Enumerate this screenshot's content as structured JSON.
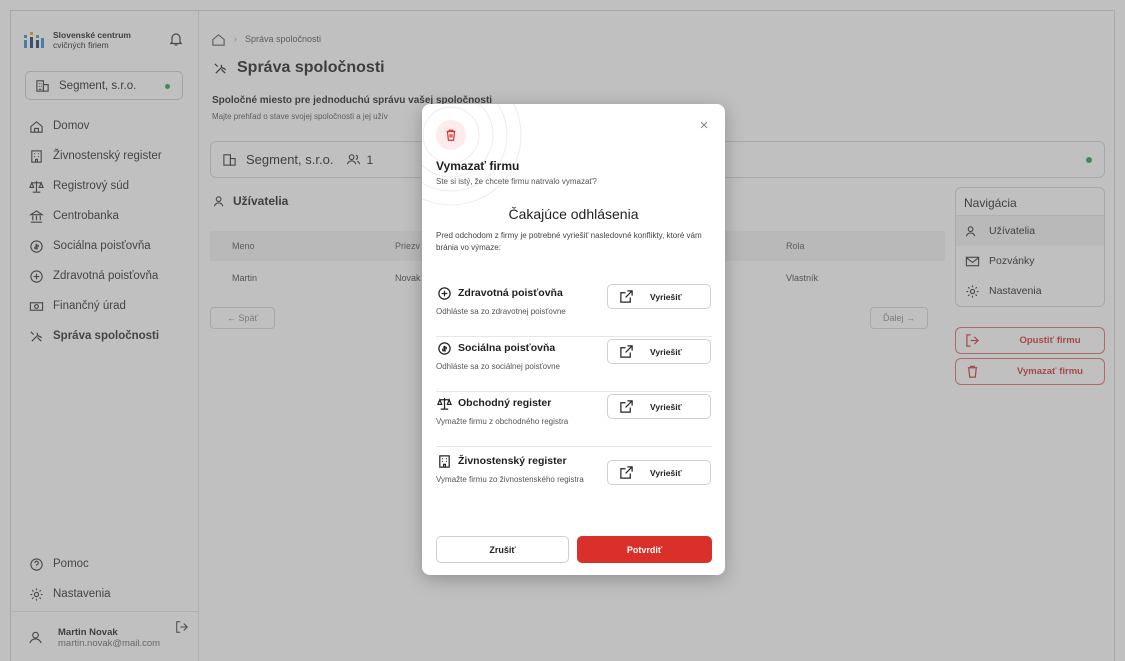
{
  "brand": {
    "line1": "Slovenské centrum",
    "line2": "cvičných firiem"
  },
  "company_selector": "Segment, s.r.o.",
  "sidebar": {
    "items": [
      {
        "label": "Domov",
        "icon": "home-icon"
      },
      {
        "label": "Živnostenský register",
        "icon": "building-icon"
      },
      {
        "label": "Registrový súd",
        "icon": "scales-icon"
      },
      {
        "label": "Centrobanka",
        "icon": "bank-icon"
      },
      {
        "label": "Sociálna poisťovňa",
        "icon": "shield-icon"
      },
      {
        "label": "Zdravotná poisťovňa",
        "icon": "medical-icon"
      },
      {
        "label": "Finančný úrad",
        "icon": "money-icon"
      },
      {
        "label": "Správa spoločnosti",
        "icon": "tools-icon"
      }
    ],
    "bottom": [
      {
        "label": "Pomoc",
        "icon": "help-icon"
      },
      {
        "label": "Nastavenia",
        "icon": "gear-icon"
      }
    ]
  },
  "user": {
    "name": "Martin Novak",
    "email": "martin.novak@mail.com"
  },
  "breadcrumb": {
    "current": "Správa spoločnosti"
  },
  "page": {
    "title": "Správa spoločnosti",
    "subtitle": "Spoločné miesto pre jednoduchú správu vašej spoločnosti",
    "description": "Majte prehľad o stave svojej spoločnosti a jej užív"
  },
  "company_bar": {
    "name": "Segment, s.r.o.",
    "members": "1"
  },
  "users": {
    "heading": "Užívatelia",
    "columns": [
      "Meno",
      "Priezv",
      "Rola"
    ],
    "rows": [
      {
        "first": "Martin",
        "last": "Novak",
        "role": "Vlastník"
      }
    ],
    "prev": "← Späť",
    "next": "Ďalej →"
  },
  "right_nav": {
    "heading": "Navigácia",
    "items": [
      "Užívatelia",
      "Pozvánky",
      "Nastavenia"
    ],
    "leave": "Opustiť firmu",
    "delete": "Vymazať firmu"
  },
  "modal": {
    "title": "Vymazať firmu",
    "subtitle": "Ste si istý, že chcete firmu natrvalo vymazať?",
    "heading": "Čakajúce odhlásenia",
    "description": "Pred odchodom z firmy je potrebné vyriešiť nasledovné konflikty, ktoré vám bránia vo výmaze:",
    "requirements": [
      {
        "title": "Zdravotná poisťovňa",
        "desc": "Odhláste sa zo zdravotnej poisťovne",
        "action": "Vyriešiť",
        "icon": "medical-icon"
      },
      {
        "title": "Sociálna poisťovňa",
        "desc": "Odhláste sa zo sociálnej poisťovne",
        "action": "Vyriešiť",
        "icon": "shield-icon"
      },
      {
        "title": "Obchodný register",
        "desc": "Vymažte firmu z obchodného registra",
        "action": "Vyriešiť",
        "icon": "scales-icon"
      },
      {
        "title": "Živnostenský register",
        "desc": "Vymažte firmu zo živnostenského registra",
        "action": "Vyriešiť",
        "icon": "building-icon"
      }
    ],
    "cancel": "Zrušiť",
    "confirm": "Potvrdiť"
  },
  "colors": {
    "danger": "#d9302a",
    "status_ok": "#2e9e4f",
    "overlay": "rgba(105,105,105,0.42)"
  }
}
